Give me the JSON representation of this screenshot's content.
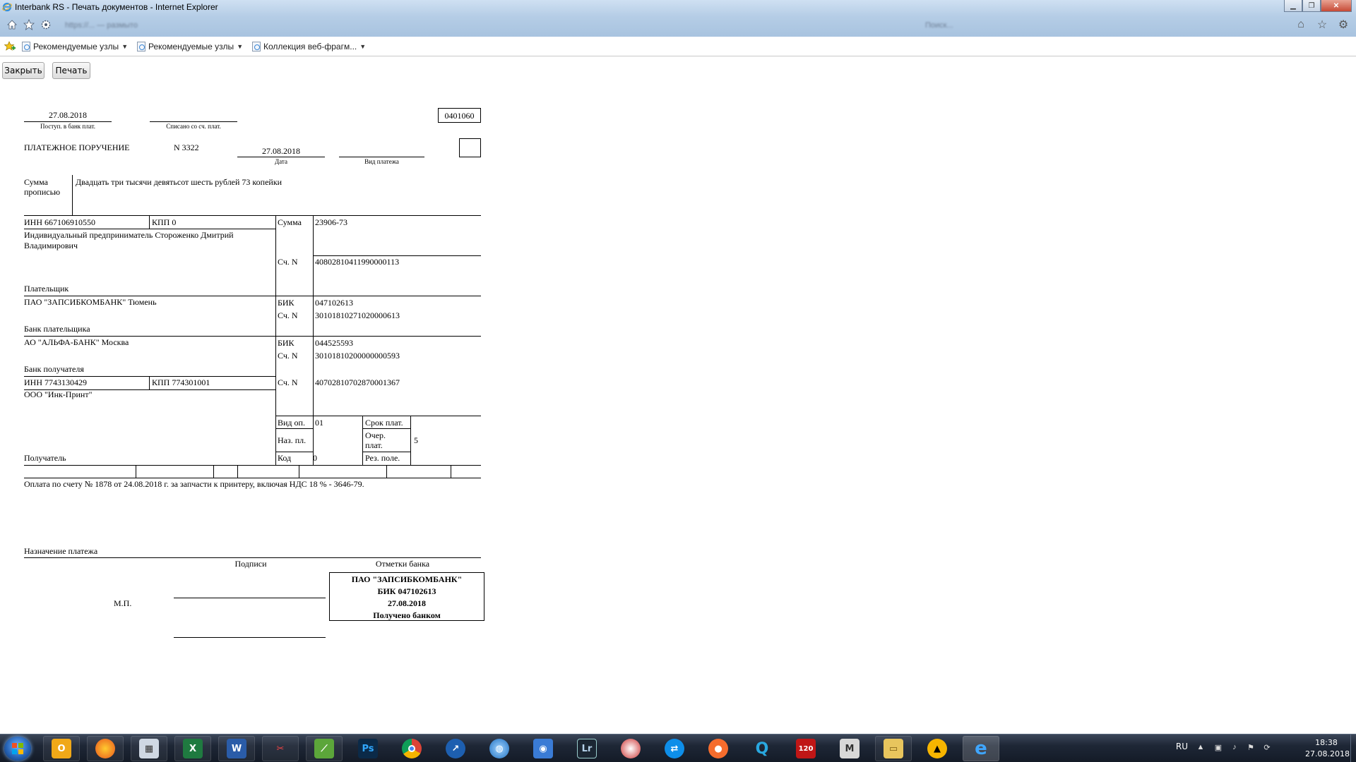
{
  "window": {
    "title": "Interbank RS - Печать документов - Internet Explorer",
    "address_text": "https://... — размыто",
    "search_text": "Поиск..."
  },
  "favorites": [
    {
      "label": "Рекомендуемые узлы"
    },
    {
      "label": "Рекомендуемые узлы"
    },
    {
      "label": "Коллекция веб-фрагм..."
    }
  ],
  "toolbar": {
    "close_label": "Закрыть",
    "print_label": "Печать"
  },
  "document": {
    "form_code": "0401060",
    "received_date": "27.08.2018",
    "received_caption": "Поступ. в банк плат.",
    "debited_caption": "Списано со сч. плат.",
    "title": "ПЛАТЕЖНОЕ ПОРУЧЕНИЕ",
    "number": "N 3322",
    "date": "27.08.2018",
    "date_caption": "Дата",
    "payment_type_caption": "Вид платежа",
    "amount_words_label": "Сумма прописью",
    "amount_words": "Двадцать три тысячи девятьсот шесть рублей 73 копейки",
    "payer_inn": "ИНН 667106910550",
    "payer_kpp": "КПП  0",
    "amount_label": "Сумма",
    "amount": "23906-73",
    "payer_name_1": "Индивидуальный предприниматель Стороженко Дмитрий",
    "payer_name_2": "Владимирович",
    "acc_label": "Сч. N",
    "payer_account": "40802810411990000113",
    "payer_caption": "Плательщик",
    "payer_bank": "ПАО \"ЗАПСИБКОМБАНК\"  Тюмень",
    "bik_label": "БИК",
    "payer_bik": "047102613",
    "payer_corr": "30101810271020000613",
    "payer_bank_caption": "Банк плательщика",
    "recipient_bank": "АО \"АЛЬФА-БАНК\"  Москва",
    "recipient_bik": "044525593",
    "recipient_corr": "30101810200000000593",
    "recipient_bank_caption": "Банк получателя",
    "recipient_inn": "ИНН 7743130429",
    "recipient_kpp": "КПП 774301001",
    "recipient_account": "40702810702870001367",
    "recipient_name": "ООО \"Инк-Принт\"",
    "vid_op_label": "Вид оп.",
    "vid_op": "01",
    "srok_label": "Срок плат.",
    "naz_label": "Наз. пл.",
    "ochered_label_1": "Очер.",
    "ochered_label_2": "плат.",
    "ochered": "5",
    "kod_label": "Код",
    "kod": "0",
    "res_label": "Рез. поле.",
    "recipient_caption": "Получатель",
    "purpose": "Оплата по счету № 1878 от 24.08.2018 г. за запчасти к принтеру, включая НДС 18 % - 3646-79.",
    "purpose_caption": "Назначение платежа",
    "signatures_caption": "Подписи",
    "bank_marks_caption": "Отметки банка",
    "mp": "М.П.",
    "stamp_line1": "ПАО \"ЗАПСИБКОМБАНК\"",
    "stamp_line2": "БИК 047102613",
    "stamp_line3": "27.08.2018",
    "stamp_line4": "Получено банком"
  },
  "taskbar": {
    "language": "RU",
    "time": "18:38",
    "date": "27.08.2018",
    "apps": [
      "Outlook",
      "Firefox",
      "Калькулятор",
      "Excel",
      "Word",
      "Ножницы",
      "Picasa",
      "Photoshop",
      "Chrome",
      "TeamViewer-like",
      "Сеть",
      "Камера",
      "Lightroom",
      "Браузер",
      "TeamViewer",
      "Origin",
      "Quik",
      "120%",
      "Mega",
      "Проводник",
      "Avast",
      "Internet Explorer"
    ]
  }
}
